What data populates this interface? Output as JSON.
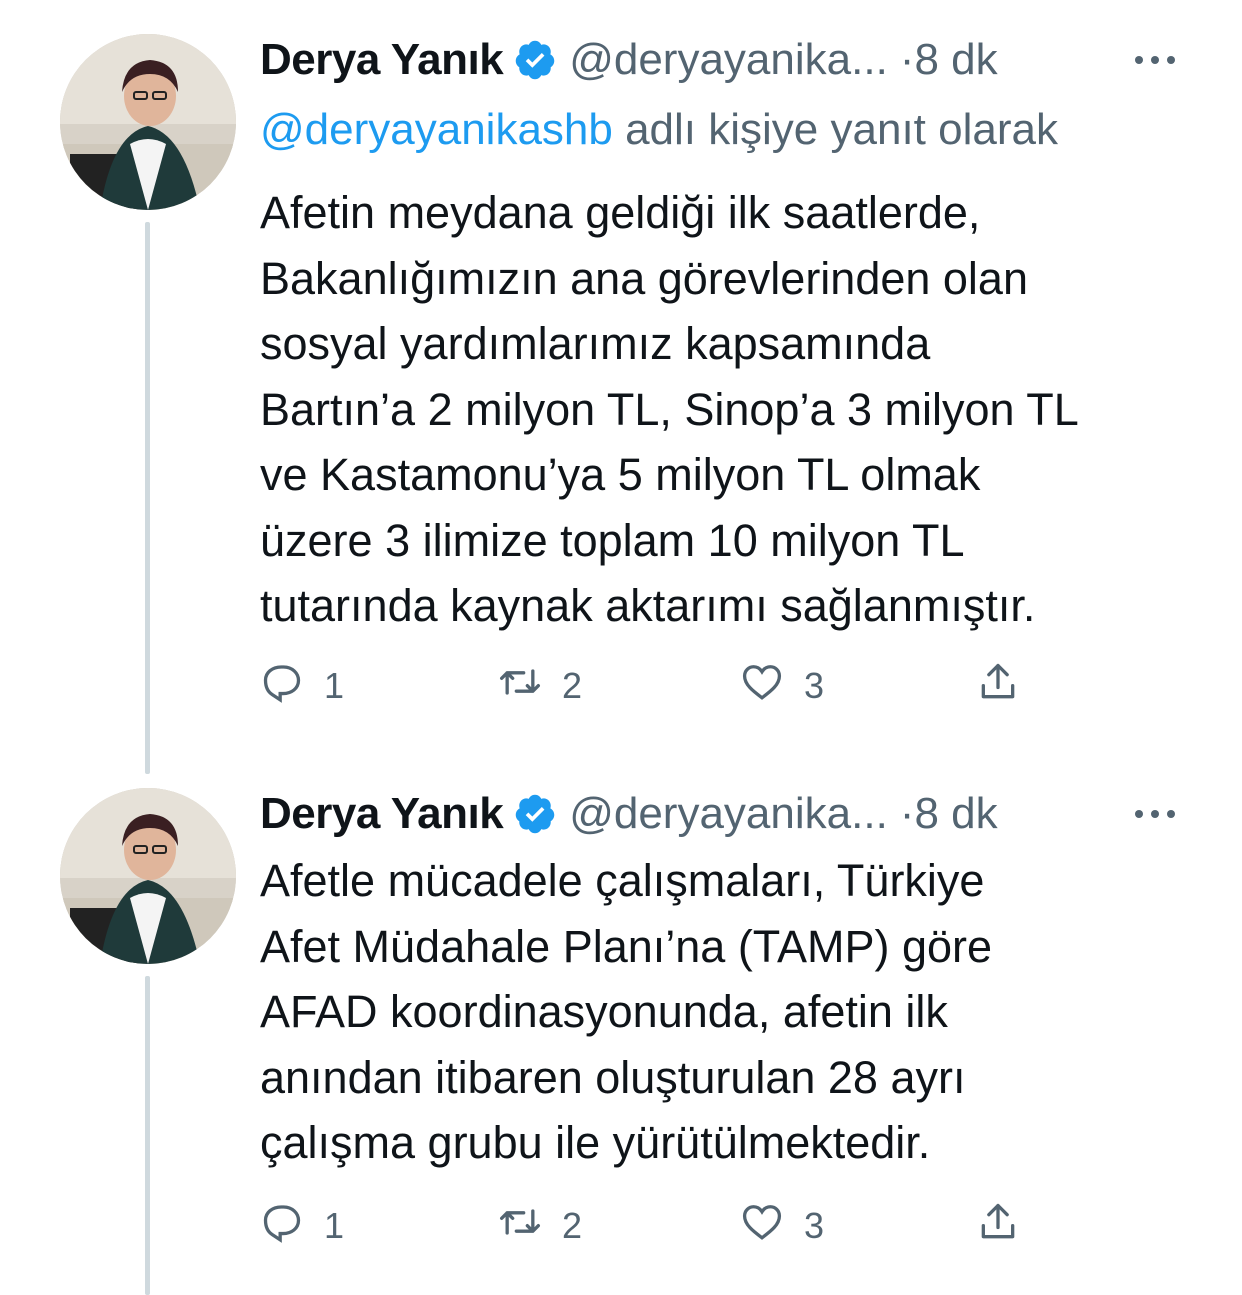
{
  "tweets": [
    {
      "name": "Derya Yanık",
      "handle": "@deryayanika...",
      "separator": "·",
      "time": "8 dk",
      "reply_prefix": "@deryayanikashb",
      "reply_suffix": " adlı kişiye yanıt olarak",
      "lines": [
        "Afetin meydana geldiği ilk saatlerde,",
        "Bakanlığımızın ana görevlerinden olan",
        "sosyal yardımlarımız kapsamında",
        "Bartın’a 2 milyon TL, Sinop’a 3 milyon TL",
        "ve Kastamonu’ya 5 milyon TL olmak",
        "üzere 3 ilimize toplam 10 milyon TL",
        "tutarında kaynak aktarımı sağlanmıştır."
      ],
      "reply_count": "1",
      "retweet_count": "2",
      "like_count": "3"
    },
    {
      "name": "Derya Yanık",
      "handle": "@deryayanika...",
      "separator": "·",
      "time": "8 dk",
      "lines": [
        "Afetle mücadele çalışmaları, Türkiye",
        "Afet Müdahale Planı’na (TAMP) göre",
        "AFAD koordinasyonunda, afetin ilk",
        "anından itibaren oluşturulan 28 ayrı",
        "çalışma grubu ile yürütülmektedir."
      ],
      "reply_count": "1",
      "retweet_count": "2",
      "like_count": "3"
    }
  ],
  "colors": {
    "text": "#0f1419",
    "secondary": "#536471",
    "link": "#1d9bf0",
    "verified": "#1d9bf0",
    "thread_line": "#cfd9de"
  },
  "icons": [
    "verified-badge-icon",
    "more-icon",
    "reply-icon",
    "retweet-icon",
    "like-icon",
    "share-icon"
  ]
}
